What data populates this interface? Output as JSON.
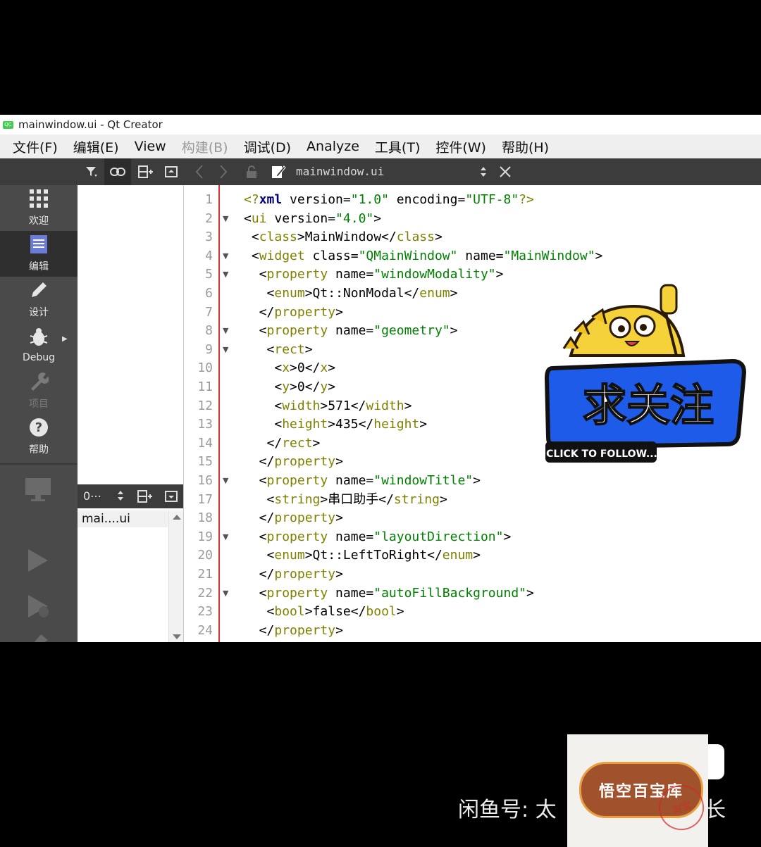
{
  "window": {
    "title": "mainwindow.ui - Qt Creator",
    "logo_text": "QC"
  },
  "menubar": [
    "文件(F)",
    "编辑(E)",
    "View",
    "构建(B)",
    "调试(D)",
    "Analyze",
    "工具(T)",
    "控件(W)",
    "帮助(H)"
  ],
  "menubar_disabled": [
    3
  ],
  "toolbar": {
    "filter_icon": "filter-icon",
    "link_icon": "link-icon",
    "split_icon": "split-add-icon",
    "close_icon": "close-pane-icon",
    "back_icon": "chevron-left-icon",
    "forward_icon": "chevron-right-icon",
    "lock_icon": "lock-icon",
    "file_icon": "edit-file-icon",
    "file_name": "mainwindow.ui",
    "close_file_icon": "close-icon"
  },
  "modes": [
    {
      "label": "欢迎",
      "icon": "grid-icon"
    },
    {
      "label": "编辑",
      "icon": "edit-doc-icon"
    },
    {
      "label": "设计",
      "icon": "pencil-icon"
    },
    {
      "label": "Debug",
      "icon": "bug-icon"
    },
    {
      "label": "项目",
      "icon": "wrench-icon"
    },
    {
      "label": "帮助",
      "icon": "help-icon"
    }
  ],
  "open_documents": {
    "header_label": "0⋯",
    "current": "mai....ui"
  },
  "editor": {
    "line_numbers": [
      "1",
      "2",
      "3",
      "4",
      "5",
      "6",
      "7",
      "8",
      "9",
      "10",
      "11",
      "12",
      "13",
      "14",
      "15",
      "16",
      "17",
      "18",
      "19",
      "20",
      "21",
      "22",
      "23",
      "24"
    ],
    "fold_markers": [
      "",
      "▼",
      "",
      "▼",
      "▼",
      "",
      "",
      "▼",
      "▼",
      "",
      "",
      "",
      "",
      "",
      "",
      "▼",
      "",
      "",
      "▼",
      "",
      "",
      "▼",
      "",
      ""
    ],
    "lines": [
      [
        [
          "t",
          "<?"
        ],
        [
          "k",
          "xml"
        ],
        [
          "p",
          " version="
        ],
        [
          "s",
          "\"1.0\""
        ],
        [
          "p",
          " encoding="
        ],
        [
          "s",
          "\"UTF-8\""
        ],
        [
          "t",
          "?>"
        ]
      ],
      [
        [
          "p",
          "<"
        ],
        [
          "t",
          "ui"
        ],
        [
          "p",
          " version="
        ],
        [
          "s",
          "\"4.0\""
        ],
        [
          "p",
          ">"
        ]
      ],
      [
        [
          "p",
          " <"
        ],
        [
          "t",
          "class"
        ],
        [
          "p",
          ">MainWindow</"
        ],
        [
          "t",
          "class"
        ],
        [
          "p",
          ">"
        ]
      ],
      [
        [
          "p",
          " <"
        ],
        [
          "t",
          "widget"
        ],
        [
          "p",
          " class="
        ],
        [
          "s",
          "\"QMainWindow\""
        ],
        [
          "p",
          " name="
        ],
        [
          "s",
          "\"MainWindow\""
        ],
        [
          "p",
          ">"
        ]
      ],
      [
        [
          "p",
          "  <"
        ],
        [
          "t",
          "property"
        ],
        [
          "p",
          " name="
        ],
        [
          "s",
          "\"windowModality\""
        ],
        [
          "p",
          ">"
        ]
      ],
      [
        [
          "p",
          "   <"
        ],
        [
          "t",
          "enum"
        ],
        [
          "p",
          ">Qt::NonModal</"
        ],
        [
          "t",
          "enum"
        ],
        [
          "p",
          ">"
        ]
      ],
      [
        [
          "p",
          "  </"
        ],
        [
          "t",
          "property"
        ],
        [
          "p",
          ">"
        ]
      ],
      [
        [
          "p",
          "  <"
        ],
        [
          "t",
          "property"
        ],
        [
          "p",
          " name="
        ],
        [
          "s",
          "\"geometry\""
        ],
        [
          "p",
          ">"
        ]
      ],
      [
        [
          "p",
          "   <"
        ],
        [
          "t",
          "rect"
        ],
        [
          "p",
          ">"
        ]
      ],
      [
        [
          "p",
          "    <"
        ],
        [
          "t",
          "x"
        ],
        [
          "p",
          ">0</"
        ],
        [
          "t",
          "x"
        ],
        [
          "p",
          ">"
        ]
      ],
      [
        [
          "p",
          "    <"
        ],
        [
          "t",
          "y"
        ],
        [
          "p",
          ">0</"
        ],
        [
          "t",
          "y"
        ],
        [
          "p",
          ">"
        ]
      ],
      [
        [
          "p",
          "    <"
        ],
        [
          "t",
          "width"
        ],
        [
          "p",
          ">571</"
        ],
        [
          "t",
          "width"
        ],
        [
          "p",
          ">"
        ]
      ],
      [
        [
          "p",
          "    <"
        ],
        [
          "t",
          "height"
        ],
        [
          "p",
          ">435</"
        ],
        [
          "t",
          "height"
        ],
        [
          "p",
          ">"
        ]
      ],
      [
        [
          "p",
          "   </"
        ],
        [
          "t",
          "rect"
        ],
        [
          "p",
          ">"
        ]
      ],
      [
        [
          "p",
          "  </"
        ],
        [
          "t",
          "property"
        ],
        [
          "p",
          ">"
        ]
      ],
      [
        [
          "p",
          "  <"
        ],
        [
          "t",
          "property"
        ],
        [
          "p",
          " name="
        ],
        [
          "s",
          "\"windowTitle\""
        ],
        [
          "p",
          ">"
        ]
      ],
      [
        [
          "p",
          "   <"
        ],
        [
          "t",
          "string"
        ],
        [
          "p",
          ">串口助手</"
        ],
        [
          "t",
          "string"
        ],
        [
          "p",
          ">"
        ]
      ],
      [
        [
          "p",
          "  </"
        ],
        [
          "t",
          "property"
        ],
        [
          "p",
          ">"
        ]
      ],
      [
        [
          "p",
          "  <"
        ],
        [
          "t",
          "property"
        ],
        [
          "p",
          " name="
        ],
        [
          "s",
          "\"layoutDirection\""
        ],
        [
          "p",
          ">"
        ]
      ],
      [
        [
          "p",
          "   <"
        ],
        [
          "t",
          "enum"
        ],
        [
          "p",
          ">Qt::LeftToRight</"
        ],
        [
          "t",
          "enum"
        ],
        [
          "p",
          ">"
        ]
      ],
      [
        [
          "p",
          "  </"
        ],
        [
          "t",
          "property"
        ],
        [
          "p",
          ">"
        ]
      ],
      [
        [
          "p",
          "  <"
        ],
        [
          "t",
          "property"
        ],
        [
          "p",
          " name="
        ],
        [
          "s",
          "\"autoFillBackground\""
        ],
        [
          "p",
          ">"
        ]
      ],
      [
        [
          "p",
          "   <"
        ],
        [
          "t",
          "bool"
        ],
        [
          "p",
          ">false</"
        ],
        [
          "t",
          "bool"
        ],
        [
          "p",
          ">"
        ]
      ],
      [
        [
          "p",
          "  </"
        ],
        [
          "t",
          "property"
        ],
        [
          "p",
          ">"
        ]
      ]
    ]
  },
  "sticker": {
    "main_text": "求关注",
    "sub_text": "CLICK TO FOLLOW..."
  },
  "watermark": {
    "prefix": "闲鱼号: 太",
    "suffix": "长",
    "logo": "悟空百宝库",
    "seal": "淘宝"
  },
  "colors": {
    "tag": "#808000",
    "string": "#008000",
    "keyword": "#000080",
    "sticker_blue": "#1e5be8",
    "sticker_yellow": "#f6d23a"
  }
}
